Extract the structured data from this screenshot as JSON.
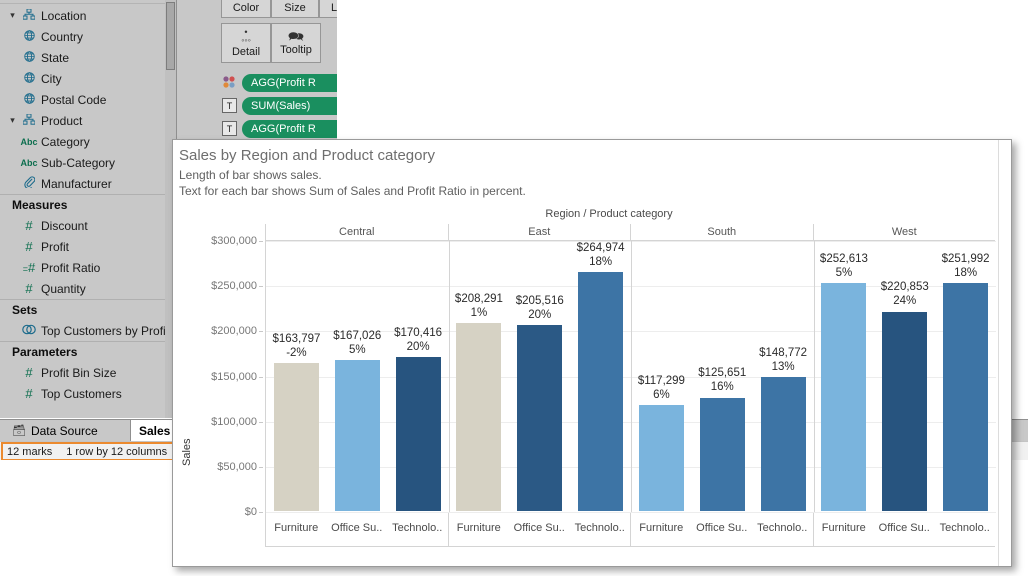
{
  "data_pane": {
    "groups": [
      {
        "label": "Location",
        "icon": "hierarchy-icon",
        "expanded": true,
        "children": [
          {
            "label": "Country",
            "icon": "globe-icon"
          },
          {
            "label": "State",
            "icon": "globe-icon"
          },
          {
            "label": "City",
            "icon": "globe-icon"
          },
          {
            "label": "Postal Code",
            "icon": "globe-icon"
          }
        ]
      },
      {
        "label": "Product",
        "icon": "hierarchy-icon",
        "expanded": true,
        "children": [
          {
            "label": "Category",
            "icon": "abc-icon"
          },
          {
            "label": "Sub-Category",
            "icon": "abc-icon"
          },
          {
            "label": "Manufacturer",
            "icon": "paperclip-icon"
          }
        ]
      }
    ],
    "sections": [
      {
        "title": "Measures",
        "items": [
          {
            "label": "Discount",
            "icon": "number-icon"
          },
          {
            "label": "Profit",
            "icon": "number-icon"
          },
          {
            "label": "Profit Ratio",
            "icon": "calculated-number-icon"
          },
          {
            "label": "Quantity",
            "icon": "number-icon"
          }
        ]
      },
      {
        "title": "Sets",
        "items": [
          {
            "label": "Top Customers by Profit",
            "icon": "set-icon"
          }
        ]
      },
      {
        "title": "Parameters",
        "items": [
          {
            "label": "Profit Bin Size",
            "icon": "number-icon"
          },
          {
            "label": "Top Customers",
            "icon": "number-icon"
          }
        ]
      }
    ]
  },
  "marks_card": {
    "buttons": [
      {
        "label": "Color",
        "icon": "color-icon"
      },
      {
        "label": "Size",
        "icon": "size-icon"
      },
      {
        "label": "L",
        "icon": "label-icon"
      },
      {
        "label": "Detail",
        "icon": "detail-icon"
      },
      {
        "label": "Tooltip",
        "icon": "tooltip-icon"
      }
    ],
    "pills": [
      {
        "label": "AGG(Profit R",
        "icon": "color-dots-icon"
      },
      {
        "label": "SUM(Sales)",
        "icon": "text-icon"
      },
      {
        "label": "AGG(Profit R",
        "icon": "text-icon"
      }
    ]
  },
  "tabs": [
    {
      "label": "Data Source",
      "icon": "database-icon",
      "active": false
    },
    {
      "label": "Sales",
      "icon": "",
      "active": true
    }
  ],
  "status": {
    "marks": "12 marks",
    "dimensions": "1 row by 12 columns",
    "highlight_color": "#eb8a2f"
  },
  "viz": {
    "title": "Sales by Region and Product category",
    "subtitle1": "Length of bar shows sales.",
    "subtitle2": "Text for each bar shows Sum of Sales and Profit Ratio in percent."
  },
  "colors": {
    "beige": "#d6d2c4",
    "light_blue": "#7ab4dd",
    "medium_blue": "#3d74a5",
    "dark_blue": "#2b5985",
    "darkest_blue": "#27547f"
  },
  "chart_data": {
    "type": "bar",
    "title": "Sales by Region and Product category",
    "subtitle": "Length of bar shows sales. Text for each bar shows Sum of Sales and Profit Ratio in percent.",
    "xlabel": "Region / Product category",
    "ylabel": "Sales",
    "ylim": [
      0,
      300000
    ],
    "yticks": [
      "$0",
      "$50,000",
      "$100,000",
      "$150,000",
      "$200,000",
      "$250,000",
      "$300,000"
    ],
    "ytick_values": [
      0,
      50000,
      100000,
      150000,
      200000,
      250000,
      300000
    ],
    "grid": true,
    "legend": "none",
    "group_label": "Region / Product category",
    "groups": [
      {
        "region": "Central",
        "bars": [
          {
            "category": "Furniture",
            "axis_label": "Furniture",
            "value": 163797,
            "value_label": "$163,797",
            "ratio_label": "-2%",
            "ratio": -0.02,
            "color": "#d6d2c4"
          },
          {
            "category": "Office Supplies",
            "axis_label": "Office Su..",
            "value": 167026,
            "value_label": "$167,026",
            "ratio_label": "5%",
            "ratio": 0.05,
            "color": "#7ab4dd"
          },
          {
            "category": "Technology",
            "axis_label": "Technolo..",
            "value": 170416,
            "value_label": "$170,416",
            "ratio_label": "20%",
            "ratio": 0.2,
            "color": "#27547f"
          }
        ]
      },
      {
        "region": "East",
        "bars": [
          {
            "category": "Furniture",
            "axis_label": "Furniture",
            "value": 208291,
            "value_label": "$208,291",
            "ratio_label": "1%",
            "ratio": 0.01,
            "color": "#d6d2c4"
          },
          {
            "category": "Office Supplies",
            "axis_label": "Office Su..",
            "value": 205516,
            "value_label": "$205,516",
            "ratio_label": "20%",
            "ratio": 0.2,
            "color": "#2b5985"
          },
          {
            "category": "Technology",
            "axis_label": "Technolo..",
            "value": 264974,
            "value_label": "$264,974",
            "ratio_label": "18%",
            "ratio": 0.18,
            "color": "#3d74a5"
          }
        ]
      },
      {
        "region": "South",
        "bars": [
          {
            "category": "Furniture",
            "axis_label": "Furniture",
            "value": 117299,
            "value_label": "$117,299",
            "ratio_label": "6%",
            "ratio": 0.06,
            "color": "#7ab4dd"
          },
          {
            "category": "Office Supplies",
            "axis_label": "Office Su..",
            "value": 125651,
            "value_label": "$125,651",
            "ratio_label": "16%",
            "ratio": 0.16,
            "color": "#3d74a5"
          },
          {
            "category": "Technology",
            "axis_label": "Technolo..",
            "value": 148772,
            "value_label": "$148,772",
            "ratio_label": "13%",
            "ratio": 0.13,
            "color": "#3d74a5"
          }
        ]
      },
      {
        "region": "West",
        "bars": [
          {
            "category": "Furniture",
            "axis_label": "Furniture",
            "value": 252613,
            "value_label": "$252,613",
            "ratio_label": "5%",
            "ratio": 0.05,
            "color": "#7ab4dd"
          },
          {
            "category": "Office Supplies",
            "axis_label": "Office Su..",
            "value": 220853,
            "value_label": "$220,853",
            "ratio_label": "24%",
            "ratio": 0.24,
            "color": "#27547f"
          },
          {
            "category": "Technology",
            "axis_label": "Technolo..",
            "value": 251992,
            "value_label": "$251,992",
            "ratio_label": "18%",
            "ratio": 0.18,
            "color": "#3d74a5"
          }
        ]
      }
    ]
  }
}
